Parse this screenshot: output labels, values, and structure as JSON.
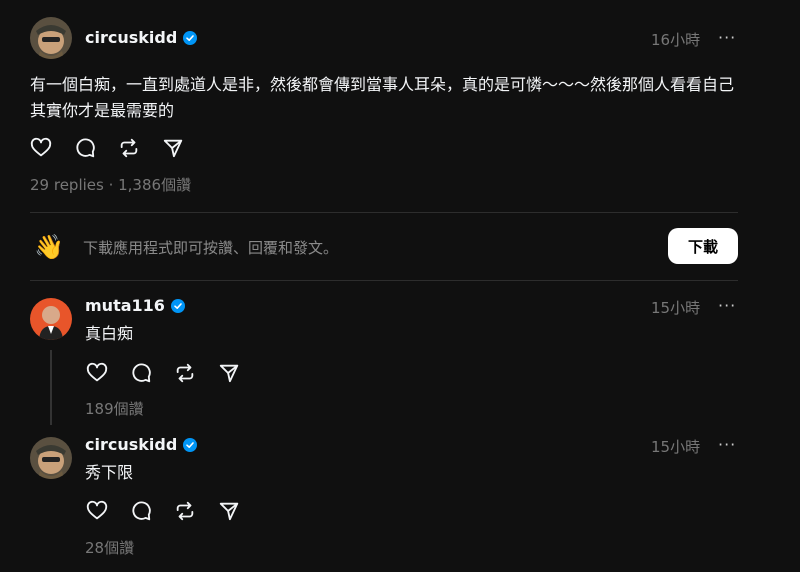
{
  "main_post": {
    "username": "circuskidd",
    "time": "16小時",
    "more": "···",
    "text": "有一個白痴，一直到處道人是非，然後都會傳到當事人耳朵，真的是可憐～～～然後那個人看看自己 其實你才是最需要的",
    "stats": "29 replies · 1,386個讚"
  },
  "promo": {
    "wave_emoji": "👋",
    "text": "下載應用程式即可按讚、回覆和發文。",
    "button_label": "下載"
  },
  "replies": [
    {
      "username": "muta116",
      "time": "15小時",
      "more": "···",
      "text": "真白痴",
      "stats": "189個讚"
    },
    {
      "username": "circuskidd",
      "time": "15小時",
      "more": "···",
      "text": "秀下限",
      "stats": "28個讚"
    }
  ],
  "colors": {
    "background": "#101010",
    "verified": "#0095f6",
    "secondary_text": "#777777"
  },
  "icons": [
    "heart-icon",
    "comment-icon",
    "repost-icon",
    "share-icon",
    "verified-icon",
    "more-icon"
  ]
}
